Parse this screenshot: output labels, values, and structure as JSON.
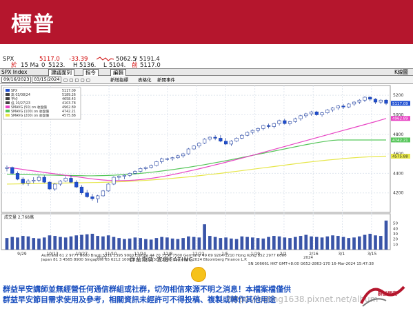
{
  "header": {
    "title": "標普"
  },
  "quote": {
    "symbol": "SPX",
    "last": "5117.0",
    "change": "-33.39",
    "range_hi": "5062.5",
    "range_sep": "/",
    "range_lo": "5191.4",
    "prefix": "於",
    "date": "15 Ma",
    "open_label": "0",
    "open": "5123.",
    "high_label": "H",
    "high": "5136.",
    "low_label": "L",
    "low": "5104.",
    "close_label": "前",
    "close": "5117.0"
  },
  "toolbar": {
    "index_label": "SPX Index",
    "table_button": "建議面列",
    "param_button": "指令",
    "edit_button": "編輯",
    "right_label": "K線圖",
    "date_from": "09/16/2023",
    "date_to": "03/15/2024",
    "tool_add": "新增指標",
    "tool_table": "表格化",
    "tool_news": "新聞事件"
  },
  "legend": {
    "items": [
      {
        "label": "SPX",
        "value": "5117.09",
        "color": "#1f4fd1"
      },
      {
        "label": "高 03/08/24",
        "value": "5189.26",
        "color": "#444444"
      },
      {
        "label": "平均",
        "value": "4658.43",
        "color": "#444444"
      },
      {
        "label": "低 10/27/23",
        "value": "4103.78",
        "color": "#444444"
      },
      {
        "label": "SMAVG (50) on 收盤價",
        "value": "4962.89",
        "color": "#e845c4"
      },
      {
        "label": "SMAVG (100) on 收盤價",
        "value": "4742.21",
        "color": "#56c65a"
      },
      {
        "label": "SMAVG (200) on 收盤價",
        "value": "4575.88",
        "color": "#e6e64a"
      }
    ]
  },
  "chart_data": {
    "type": "candlestick",
    "ylim": [
      4000,
      5300
    ],
    "y_ticks": [
      "5200",
      "5000",
      "4800",
      "4600",
      "4400",
      "4200"
    ],
    "right_tags": [
      "5117.09",
      "4962.89",
      "4742.21",
      "4575.88"
    ],
    "x_month_labels": [
      "9/29",
      "10/13",
      "10/27",
      "11/10",
      "11/24",
      "12/8",
      "12/22",
      "1/5",
      "1/19",
      "2/2",
      "2/16",
      "3/1",
      "3/15"
    ],
    "x_year_labels": [
      "2023",
      "2024"
    ],
    "volume_label": "成交量 2,768萬",
    "volume_ticks": [
      "50",
      "40",
      "30",
      "20",
      "10"
    ],
    "candles": [
      [
        4450,
        4480,
        4420,
        4460
      ],
      [
        4460,
        4470,
        4390,
        4400
      ],
      [
        4400,
        4420,
        4330,
        4340
      ],
      [
        4340,
        4360,
        4280,
        4300
      ],
      [
        4300,
        4340,
        4270,
        4320
      ],
      [
        4320,
        4360,
        4300,
        4330
      ],
      [
        4330,
        4380,
        4310,
        4360
      ],
      [
        4360,
        4380,
        4300,
        4310
      ],
      [
        4310,
        4320,
        4230,
        4240
      ],
      [
        4240,
        4300,
        4220,
        4290
      ],
      [
        4290,
        4330,
        4270,
        4320
      ],
      [
        4320,
        4370,
        4310,
        4350
      ],
      [
        4350,
        4380,
        4300,
        4310
      ],
      [
        4310,
        4330,
        4250,
        4260
      ],
      [
        4260,
        4280,
        4180,
        4200
      ],
      [
        4200,
        4230,
        4150,
        4160
      ],
      [
        4160,
        4190,
        4120,
        4140
      ],
      [
        4140,
        4180,
        4100,
        4170
      ],
      [
        4170,
        4230,
        4160,
        4220
      ],
      [
        4220,
        4300,
        4210,
        4290
      ],
      [
        4290,
        4370,
        4280,
        4360
      ],
      [
        4360,
        4380,
        4330,
        4370
      ],
      [
        4370,
        4390,
        4340,
        4380
      ],
      [
        4380,
        4410,
        4360,
        4400
      ],
      [
        4400,
        4430,
        4390,
        4420
      ],
      [
        4420,
        4460,
        4410,
        4450
      ],
      [
        4450,
        4470,
        4430,
        4460
      ],
      [
        4460,
        4490,
        4450,
        4480
      ],
      [
        4480,
        4530,
        4470,
        4520
      ],
      [
        4520,
        4560,
        4500,
        4550
      ],
      [
        4550,
        4560,
        4530,
        4550
      ],
      [
        4550,
        4570,
        4530,
        4560
      ],
      [
        4560,
        4590,
        4550,
        4580
      ],
      [
        4580,
        4610,
        4560,
        4600
      ],
      [
        4600,
        4660,
        4590,
        4650
      ],
      [
        4650,
        4690,
        4640,
        4680
      ],
      [
        4680,
        4720,
        4660,
        4710
      ],
      [
        4710,
        4760,
        4700,
        4750
      ],
      [
        4750,
        4780,
        4730,
        4770
      ],
      [
        4770,
        4790,
        4740,
        4760
      ],
      [
        4760,
        4790,
        4720,
        4730
      ],
      [
        4730,
        4760,
        4690,
        4700
      ],
      [
        4700,
        4740,
        4680,
        4730
      ],
      [
        4730,
        4770,
        4720,
        4760
      ],
      [
        4760,
        4800,
        4750,
        4790
      ],
      [
        4790,
        4830,
        4780,
        4820
      ],
      [
        4820,
        4850,
        4800,
        4840
      ],
      [
        4840,
        4870,
        4820,
        4860
      ],
      [
        4860,
        4900,
        4840,
        4890
      ],
      [
        4890,
        4910,
        4860,
        4880
      ],
      [
        4880,
        4920,
        4860,
        4910
      ],
      [
        4910,
        4950,
        4890,
        4940
      ],
      [
        4940,
        4960,
        4900,
        4910
      ],
      [
        4910,
        4940,
        4890,
        4930
      ],
      [
        4930,
        4970,
        4920,
        4960
      ],
      [
        4960,
        5000,
        4940,
        4990
      ],
      [
        4990,
        5020,
        4970,
        5010
      ],
      [
        5010,
        5040,
        4990,
        5030
      ],
      [
        5030,
        5040,
        4990,
        5000
      ],
      [
        5000,
        5030,
        4980,
        5020
      ],
      [
        5020,
        5060,
        5010,
        5050
      ],
      [
        5050,
        5080,
        5030,
        5070
      ],
      [
        5070,
        5100,
        5050,
        5090
      ],
      [
        5090,
        5110,
        5060,
        5080
      ],
      [
        5080,
        5120,
        5070,
        5110
      ],
      [
        5110,
        5140,
        5090,
        5130
      ],
      [
        5130,
        5160,
        5110,
        5150
      ],
      [
        5150,
        5190,
        5130,
        5180
      ],
      [
        5180,
        5190,
        5140,
        5160
      ],
      [
        5160,
        5170,
        5110,
        5130
      ],
      [
        5130,
        5160,
        5110,
        5150
      ],
      [
        5150,
        5160,
        5100,
        5117
      ]
    ],
    "volume": [
      22,
      24,
      23,
      26,
      25,
      22,
      21,
      23,
      27,
      26,
      24,
      23,
      25,
      27,
      28,
      29,
      30,
      26,
      25,
      27,
      24,
      22,
      20,
      21,
      23,
      22,
      20,
      19,
      22,
      24,
      23,
      21,
      20,
      22,
      25,
      24,
      23,
      48,
      26,
      24,
      22,
      23,
      21,
      20,
      25,
      24,
      23,
      22,
      21,
      24,
      26,
      25,
      23,
      22,
      24,
      26,
      28,
      25,
      24,
      23,
      25,
      27,
      26,
      24,
      22,
      23,
      25,
      28,
      30,
      27,
      26,
      55
    ],
    "ma50": [
      4460,
      4455,
      4448,
      4440,
      4432,
      4425,
      4418,
      4410,
      4402,
      4395,
      4388,
      4380,
      4372,
      4365,
      4358,
      4350,
      4343,
      4337,
      4332,
      4328,
      4326,
      4325,
      4326,
      4328,
      4331,
      4336,
      4342,
      4349,
      4357,
      4366,
      4376,
      4387,
      4398,
      4410,
      4422,
      4434,
      4447,
      4460,
      4473,
      4487,
      4500,
      4514,
      4528,
      4542,
      4556,
      4570,
      4585,
      4600,
      4615,
      4630,
      4645,
      4660,
      4675,
      4690,
      4705,
      4720,
      4735,
      4750,
      4765,
      4780,
      4795,
      4810,
      4825,
      4840,
      4855,
      4870,
      4885,
      4900,
      4915,
      4930,
      4946,
      4962
    ],
    "ma100": [
      4390,
      4389,
      4388,
      4387,
      4386,
      4385,
      4384,
      4383,
      4382,
      4381,
      4380,
      4379,
      4378,
      4377,
      4376,
      4375,
      4375,
      4376,
      4377,
      4379,
      4381,
      4384,
      4387,
      4391,
      4395,
      4400,
      4405,
      4411,
      4417,
      4424,
      4431,
      4438,
      4446,
      4454,
      4462,
      4471,
      4480,
      4489,
      4499,
      4509,
      4519,
      4529,
      4540,
      4551,
      4562,
      4573,
      4584,
      4595,
      4606,
      4617,
      4628,
      4639,
      4650,
      4661,
      4672,
      4683,
      4694,
      4704,
      4714,
      4723,
      4731,
      4738,
      4742,
      4742,
      4742,
      4742,
      4742,
      4742,
      4742,
      4742,
      4742,
      4742
    ],
    "ma200": [
      4290,
      4291,
      4292,
      4293,
      4294,
      4295,
      4296,
      4297,
      4298,
      4299,
      4300,
      4301,
      4302,
      4303,
      4304,
      4305,
      4306,
      4307,
      4308,
      4310,
      4312,
      4314,
      4316,
      4319,
      4322,
      4325,
      4328,
      4332,
      4336,
      4340,
      4344,
      4349,
      4354,
      4359,
      4364,
      4370,
      4376,
      4382,
      4388,
      4394,
      4400,
      4407,
      4414,
      4421,
      4428,
      4435,
      4442,
      4449,
      4456,
      4463,
      4470,
      4477,
      4484,
      4491,
      4498,
      4505,
      4512,
      4518,
      4524,
      4530,
      4536,
      4541,
      4546,
      4551,
      4556,
      4560,
      4564,
      4567,
      4570,
      4573,
      4575,
      4576
    ]
  },
  "footer": {
    "exchanges": "Australia 61 2 9777 8600 Brazil 5511 2395 9000 Europe 44 20 7330 7500 Germany 49 69 9204 1210 Hong Kong 852 2977 6000",
    "exchanges2": "Japan 81 3 4565 8900        Singapore 65 6212 1000        U.S. 1 212 318 2000        Copyright 2024 Bloomberg Finance L.P.",
    "session": "SN 106661 HKT GMT+8:00 G652-2863-170 16-Mar-2024 15:47:38",
    "eating": "群益期貨 宜庭EATING",
    "disclaimer1": "群益早安講師並無經營任何通信群組或社群，切勿相信來源不明之消息！本檔案檔僅供",
    "disclaimer2": "群益早安節目需求使用及參考，相關資訊未經許可不得投稿、複製或轉作其他用途",
    "watermark": "https://eating1638.pixnet.net/album",
    "brand": "群益期貨"
  },
  "colors": {
    "brand_red": "#b5162d",
    "up_candle": "#ffffff",
    "down_candle": "#1f4fd1",
    "ma50": "#e845c4",
    "ma100": "#56c65a",
    "ma200": "#e6e64a"
  }
}
